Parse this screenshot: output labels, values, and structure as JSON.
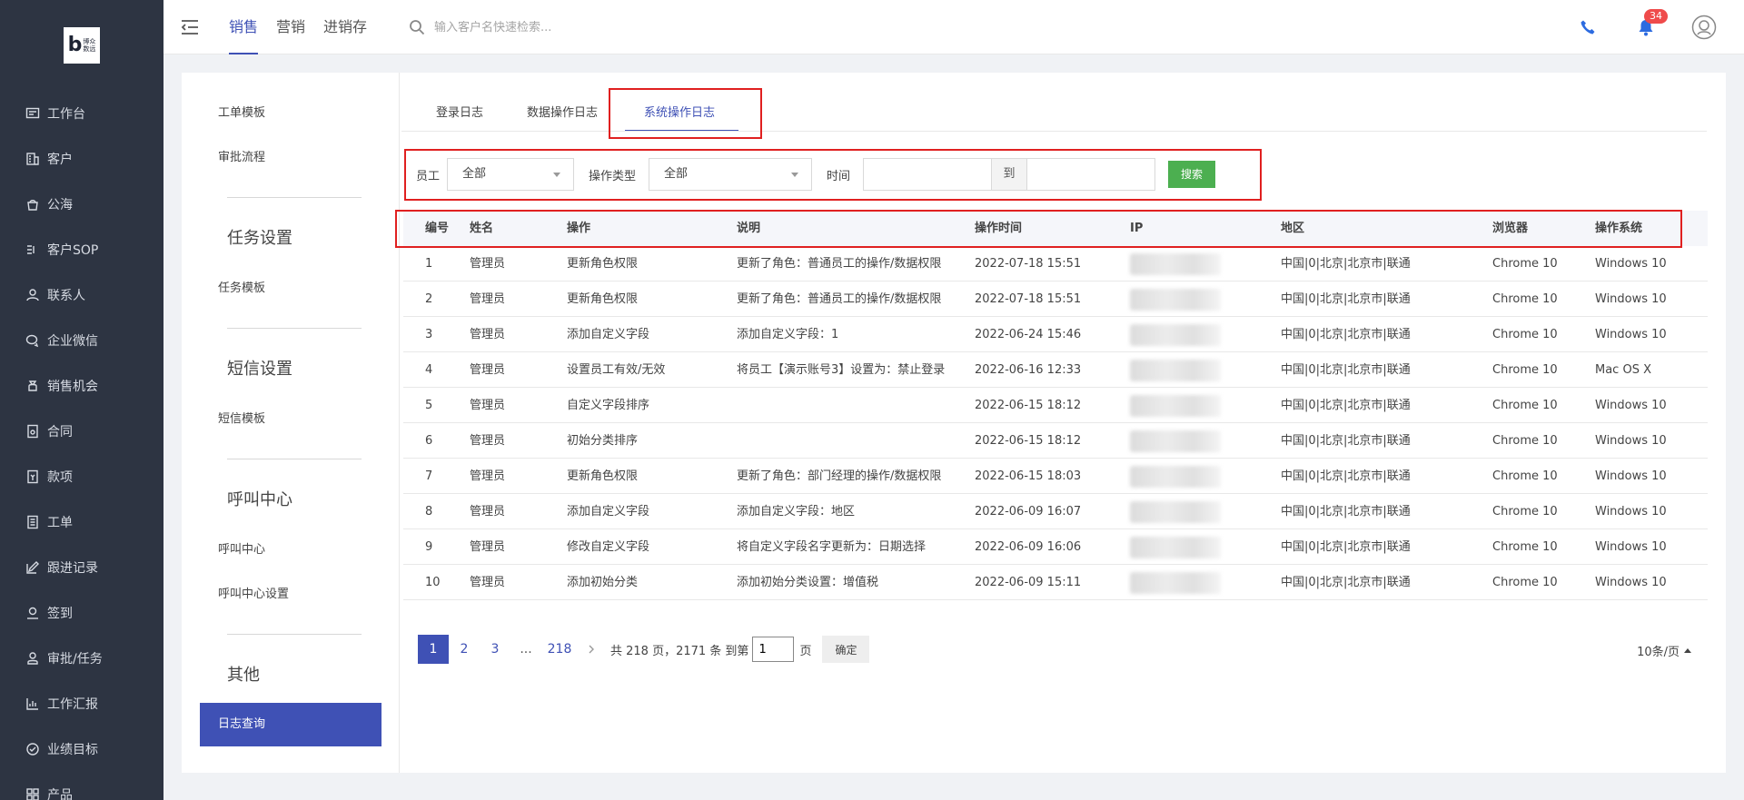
{
  "logo": {
    "letter": "b",
    "text": "博众\n数远"
  },
  "sidebar": {
    "items": [
      {
        "label": "工作台",
        "icon": "dashboard-icon"
      },
      {
        "label": "客户",
        "icon": "building-icon"
      },
      {
        "label": "公海",
        "icon": "pool-icon"
      },
      {
        "label": "客户SOP",
        "icon": "sop-icon"
      },
      {
        "label": "联系人",
        "icon": "contact-icon"
      },
      {
        "label": "企业微信",
        "icon": "wechat-icon"
      },
      {
        "label": "销售机会",
        "icon": "moneybag-icon"
      },
      {
        "label": "合同",
        "icon": "contract-icon"
      },
      {
        "label": "款项",
        "icon": "payment-icon"
      },
      {
        "label": "工单",
        "icon": "ticket-icon"
      },
      {
        "label": "跟进记录",
        "icon": "edit-icon"
      },
      {
        "label": "签到",
        "icon": "checkin-icon"
      },
      {
        "label": "审批/任务",
        "icon": "approval-icon"
      },
      {
        "label": "工作汇报",
        "icon": "report-icon"
      },
      {
        "label": "业绩目标",
        "icon": "target-icon"
      },
      {
        "label": "产品",
        "icon": "product-icon"
      }
    ]
  },
  "topbar": {
    "tabs": [
      "销售",
      "营销",
      "进销存"
    ],
    "active_tab": 0,
    "search_placeholder": "输入客户名快速检索...",
    "notification_count": "34"
  },
  "subnav": {
    "links_top": [
      "工单模板",
      "审批流程"
    ],
    "sections": [
      {
        "title": "任务设置",
        "links": [
          "任务模板"
        ]
      },
      {
        "title": "短信设置",
        "links": [
          "短信模板"
        ]
      },
      {
        "title": "呼叫中心",
        "links": [
          "呼叫中心",
          "呼叫中心设置"
        ]
      },
      {
        "title": "其他",
        "links": [
          "日志查询"
        ]
      }
    ],
    "active_link": "日志查询"
  },
  "log_tabs": {
    "items": [
      "登录日志",
      "数据操作日志",
      "系统操作日志"
    ],
    "active": 2
  },
  "filter": {
    "employee_label": "员工",
    "employee_value": "全部",
    "type_label": "操作类型",
    "type_value": "全部",
    "time_label": "时间",
    "time_to": "到",
    "search_button": "搜索"
  },
  "table": {
    "columns": [
      "编号",
      "姓名",
      "操作",
      "说明",
      "操作时间",
      "IP",
      "地区",
      "浏览器",
      "操作系统"
    ],
    "rows": [
      [
        "1",
        "管理员",
        "更新角色权限",
        "更新了角色：普通员工的操作/数据权限",
        "2022-07-18 15:51",
        "",
        "中国|0|北京|北京市|联通",
        "Chrome 10",
        "Windows 10"
      ],
      [
        "2",
        "管理员",
        "更新角色权限",
        "更新了角色：普通员工的操作/数据权限",
        "2022-07-18 15:51",
        "",
        "中国|0|北京|北京市|联通",
        "Chrome 10",
        "Windows 10"
      ],
      [
        "3",
        "管理员",
        "添加自定义字段",
        "添加自定义字段：1",
        "2022-06-24 15:46",
        "",
        "中国|0|北京|北京市|联通",
        "Chrome 10",
        "Windows 10"
      ],
      [
        "4",
        "管理员",
        "设置员工有效/无效",
        "将员工【演示账号3】设置为：禁止登录",
        "2022-06-16 12:33",
        "",
        "中国|0|北京|北京市|联通",
        "Chrome 10",
        "Mac OS X"
      ],
      [
        "5",
        "管理员",
        "自定义字段排序",
        "",
        "2022-06-15 18:12",
        "",
        "中国|0|北京|北京市|联通",
        "Chrome 10",
        "Windows 10"
      ],
      [
        "6",
        "管理员",
        "初始分类排序",
        "",
        "2022-06-15 18:12",
        "",
        "中国|0|北京|北京市|联通",
        "Chrome 10",
        "Windows 10"
      ],
      [
        "7",
        "管理员",
        "更新角色权限",
        "更新了角色：部门经理的操作/数据权限",
        "2022-06-15 18:03",
        "",
        "中国|0|北京|北京市|联通",
        "Chrome 10",
        "Windows 10"
      ],
      [
        "8",
        "管理员",
        "添加自定义字段",
        "添加自定义字段：地区",
        "2022-06-09 16:07",
        "",
        "中国|0|北京|北京市|联通",
        "Chrome 10",
        "Windows 10"
      ],
      [
        "9",
        "管理员",
        "修改自定义字段",
        "将自定义字段名字更新为：日期选择",
        "2022-06-09 16:06",
        "",
        "中国|0|北京|北京市|联通",
        "Chrome 10",
        "Windows 10"
      ],
      [
        "10",
        "管理员",
        "添加初始分类",
        "添加初始分类设置：增值税",
        "2022-06-09 15:11",
        "",
        "中国|0|北京|北京市|联通",
        "Chrome 10",
        "Windows 10"
      ]
    ]
  },
  "pagination": {
    "pages": [
      "1",
      "2",
      "3",
      "...",
      "218"
    ],
    "current": "1",
    "summary": "共 218 页，2171 条 到第",
    "goto_value": "1",
    "page_unit": "页",
    "confirm": "确定",
    "page_size": "10条/页"
  },
  "colors": {
    "sidebar_bg": "#2d3442",
    "accent": "#3f51b5",
    "search_button": "#4caf50",
    "highlight_box": "#e02020",
    "badge": "#ef4b4b"
  }
}
